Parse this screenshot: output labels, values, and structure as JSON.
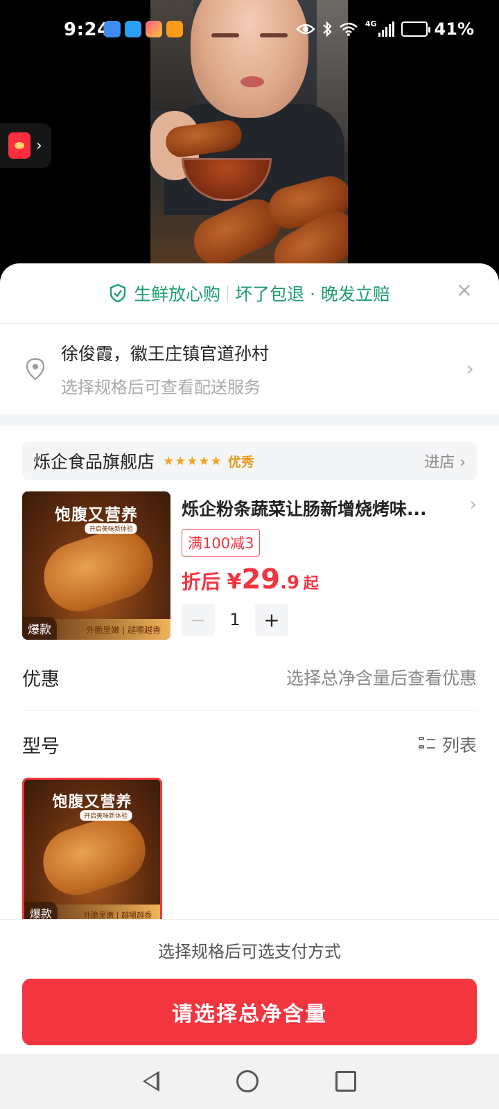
{
  "status_bar": {
    "time": "9:24",
    "signal_label": "4G",
    "battery": "41%"
  },
  "sheet": {
    "banner": {
      "left": "生鲜放心购",
      "right": "坏了包退 · 晚发立赔"
    },
    "address": {
      "name_line": "徐俊霞，徽王庄镇官道孙村",
      "hint": "选择规格后可查看配送服务"
    },
    "store": {
      "name": "烁企食品旗舰店",
      "stars": "★★★★★",
      "grade": "优秀",
      "enter": "进店 ›"
    },
    "product": {
      "image_title": "饱腹又营养",
      "image_subtitle": "开启美味新体验",
      "image_badge": "爆款",
      "image_slogan": "外脆里嫩 | 越嚼越香",
      "title": "烁企粉条蔬菜让肠新增烧烤味...",
      "coupon": "满100减3",
      "price_label": "折后",
      "price_symbol": "¥",
      "price_int": "29",
      "price_dec": ".9",
      "price_suffix": "起",
      "quantity": "1",
      "minus": "−",
      "plus": "+"
    },
    "discount": {
      "label": "优惠",
      "hint": "选择总净含量后查看优惠"
    },
    "model": {
      "label": "型号",
      "list_label": "列表",
      "variant": {
        "title": "饱腹又营养",
        "subtitle": "开启美味新体验",
        "badge": "爆款",
        "slogan": "外脆里嫩 | 越嚼越香"
      }
    }
  },
  "footer": {
    "note": "选择规格后可选支付方式",
    "cta": "请选择总净含量"
  },
  "colors": {
    "accent_red": "#f2353f",
    "trust_green": "#1c9e6c",
    "star_gold": "#f0a41d"
  }
}
